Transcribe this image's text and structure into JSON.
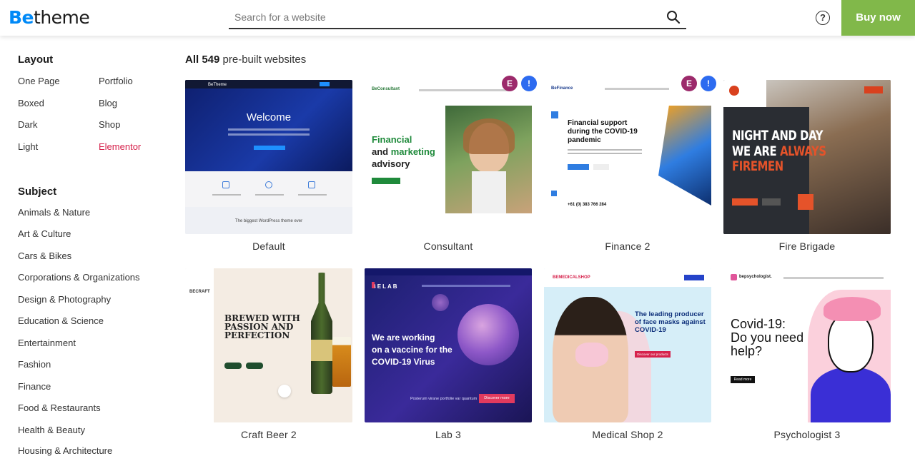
{
  "header": {
    "logo_be": "Be",
    "logo_theme": "theme",
    "search_placeholder": "Search for a website",
    "help": "?",
    "buy_label": "Buy now"
  },
  "sidebar": {
    "layout_heading": "Layout",
    "layout_items": [
      "One Page",
      "Portfolio",
      "Boxed",
      "Blog",
      "Dark",
      "Shop",
      "Light",
      "Elementor"
    ],
    "subject_heading": "Subject",
    "subject_items": [
      "Animals & Nature",
      "Art & Culture",
      "Cars & Bikes",
      "Corporations & Organizations",
      "Design & Photography",
      "Education & Science",
      "Entertainment",
      "Fashion",
      "Finance",
      "Food & Restaurants",
      "Health & Beauty",
      "Housing & Architecture"
    ]
  },
  "main": {
    "title_prefix": "All 549",
    "title_suffix": " pre-built websites",
    "cards": [
      {
        "label": "Default"
      },
      {
        "label": "Consultant"
      },
      {
        "label": "Finance 2"
      },
      {
        "label": "Fire Brigade"
      },
      {
        "label": "Craft Beer 2"
      },
      {
        "label": "Lab 3"
      },
      {
        "label": "Medical Shop 2"
      },
      {
        "label": "Psychologist 3"
      }
    ]
  },
  "thumbs": {
    "default_welcome": "Welcome",
    "default_caption": "The biggest WordPress theme ever",
    "consultant_line1": "Financial",
    "consultant_line2": "and marketing",
    "consultant_line3": "advisory",
    "finance_line1": "Financial support",
    "finance_line2": "during the COVID-19",
    "finance_line3": "pandemic",
    "finance_phone": "+61 (0) 383 766 284",
    "fire_line1": "NIGHT AND DAY",
    "fire_line2a": "WE ARE ",
    "fire_line2b": "ALWAYS",
    "fire_line3": "FIREMEN",
    "beer_line1": "BREWED WITH",
    "beer_line2": "PASSION AND",
    "beer_line3": "PERFECTION",
    "beer_brand": "BECRAFT",
    "lab_brand": "BELAB",
    "lab_line1": "We are working",
    "lab_line2": "on a vaccine for the",
    "lab_line3": "COVID-19 Virus",
    "lab_caption": "Posterum virane portfolie var quantum",
    "lab_btn": "Discover more",
    "med_brand": "BEMEDICALSHOP",
    "med_line1": "The leading producer",
    "med_line2": "of face masks against",
    "med_line3": "COVID-19",
    "med_btn": "Discover our products",
    "psy_brand": "bepsychologist.",
    "psy_line1": "Covid-19:",
    "psy_line2": "Do you need",
    "psy_line3": "help?",
    "psy_btn": "Read more",
    "finance_brand": "BeFinance",
    "consultant_brand": "BeConsultant"
  },
  "colors": {
    "brand_blue": "#0089f7",
    "buy_green": "#81b84a",
    "elementor_active": "#d6214b"
  }
}
